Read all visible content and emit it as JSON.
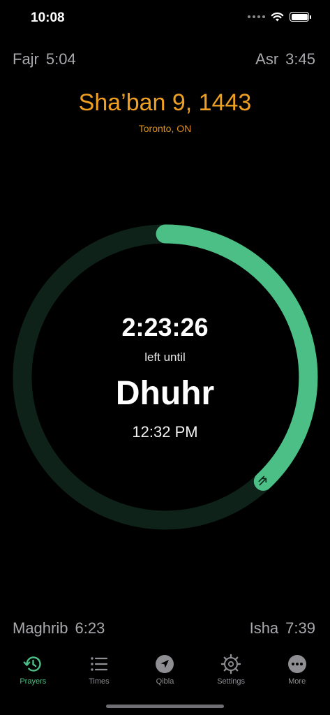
{
  "status_bar": {
    "time": "10:08"
  },
  "prayers": {
    "top_left": {
      "name": "Fajr",
      "time": "5:04"
    },
    "top_right": {
      "name": "Asr",
      "time": "3:45"
    },
    "bottom_left": {
      "name": "Maghrib",
      "time": "6:23"
    },
    "bottom_right": {
      "name": "Isha",
      "time": "7:39"
    }
  },
  "header": {
    "hijri_date": "Sha’ban 9, 1443",
    "location": "Toronto, ON"
  },
  "countdown": {
    "remaining": "2:23:26",
    "caption": "left until",
    "next_prayer": "Dhuhr",
    "next_time": "12:32 PM",
    "progress_fraction": 0.38
  },
  "tabs": [
    {
      "label": "Prayers",
      "icon": "history-icon",
      "active": true
    },
    {
      "label": "Times",
      "icon": "list-icon",
      "active": false
    },
    {
      "label": "Qibla",
      "icon": "compass-arrow-icon",
      "active": false
    },
    {
      "label": "Settings",
      "icon": "gear-icon",
      "active": false
    },
    {
      "label": "More",
      "icon": "more-icon",
      "active": false
    }
  ],
  "colors": {
    "accent": "#4cbf86",
    "date": "#f0a020",
    "track": "#0f2219",
    "inactive": "#8e8e93"
  }
}
